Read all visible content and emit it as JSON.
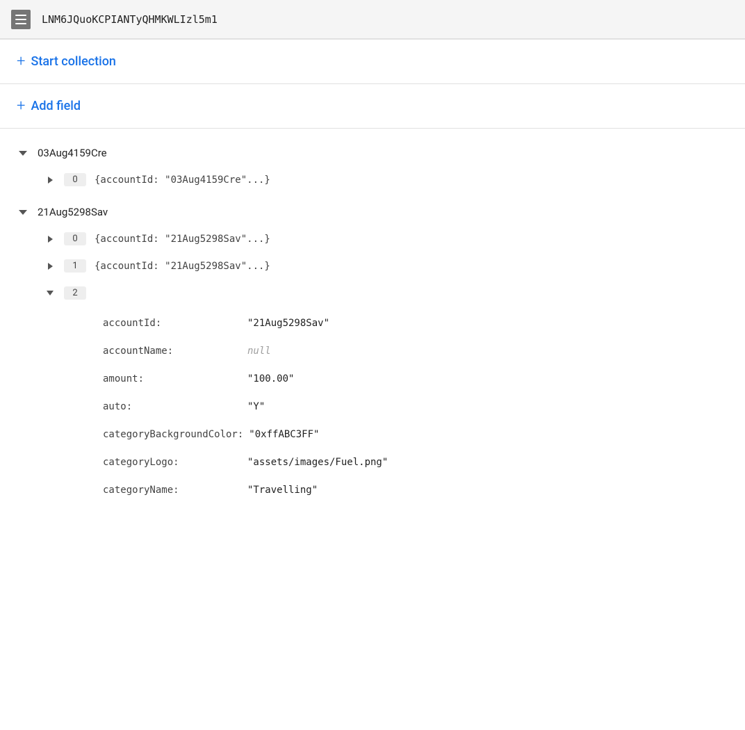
{
  "header": {
    "icon_label": "menu-icon",
    "title": "LNM6JQuoKCPIANTyQHMKWLIzl5m1"
  },
  "actions": [
    {
      "id": "start-collection",
      "label": "Start collection",
      "plus": "+"
    },
    {
      "id": "add-field",
      "label": "Add field",
      "plus": "+"
    }
  ],
  "collections": [
    {
      "id": "03Aug4159Cre",
      "name": "03Aug4159Cre",
      "expanded": true,
      "documents": [
        {
          "index": "0",
          "preview": "{accountId: \"03Aug4159Cre\"...}",
          "expanded": false,
          "fields": []
        }
      ]
    },
    {
      "id": "21Aug5298Sav",
      "name": "21Aug5298Sav",
      "expanded": true,
      "documents": [
        {
          "index": "0",
          "preview": "{accountId: \"21Aug5298Sav\"...}",
          "expanded": false,
          "fields": []
        },
        {
          "index": "1",
          "preview": "{accountId: \"21Aug5298Sav\"...}",
          "expanded": false,
          "fields": []
        },
        {
          "index": "2",
          "preview": "",
          "expanded": true,
          "fields": [
            {
              "key": "accountId:",
              "value": "\"21Aug5298Sav\"",
              "type": "string"
            },
            {
              "key": "accountName:",
              "value": "null",
              "type": "null"
            },
            {
              "key": "amount:",
              "value": "\"100.00\"",
              "type": "string"
            },
            {
              "key": "auto:",
              "value": "\"Y\"",
              "type": "string"
            },
            {
              "key": "categoryBackgroundColor:",
              "value": "\"0xffABC3FF\"",
              "type": "string"
            },
            {
              "key": "categoryLogo:",
              "value": "\"assets/images/Fuel.png\"",
              "type": "string"
            },
            {
              "key": "categoryName:",
              "value": "\"Travelling\"",
              "type": "string"
            }
          ]
        }
      ]
    }
  ]
}
